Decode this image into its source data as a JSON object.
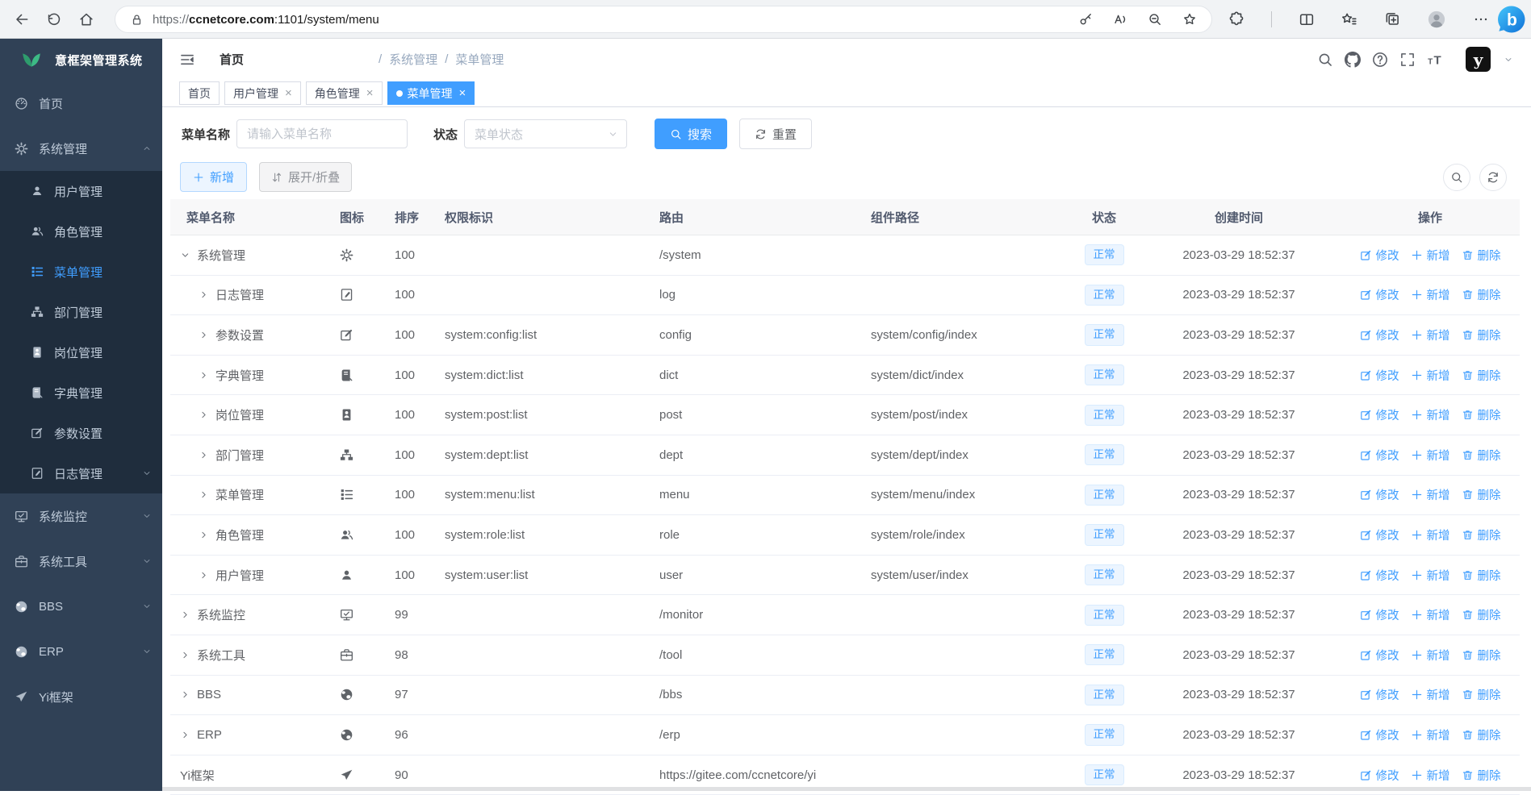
{
  "browser": {
    "url_prefix": "https://",
    "url_host": "ccnetcore.com",
    "url_path": ":1101/system/menu",
    "nav_buttons": [
      {
        "name": "back-button",
        "icon": "arrow-left"
      },
      {
        "name": "refresh-button",
        "icon": "reload"
      },
      {
        "name": "home-button",
        "icon": "home"
      }
    ],
    "address_icons": [
      {
        "name": "password-key-icon",
        "icon": "key"
      },
      {
        "name": "read-aloud-icon",
        "icon": "read-aloud"
      },
      {
        "name": "zoom-out-icon",
        "icon": "zoom-out"
      },
      {
        "name": "add-favorite-icon",
        "icon": "star-plus"
      }
    ],
    "action_icons": [
      {
        "name": "extensions-icon",
        "icon": "puzzle"
      },
      {
        "name": "toolbar-divider",
        "icon": "divider"
      },
      {
        "name": "split-screen-icon",
        "icon": "split"
      },
      {
        "name": "favorites-icon",
        "icon": "star-lines"
      },
      {
        "name": "collections-icon",
        "icon": "collections"
      },
      {
        "name": "profile-avatar-icon",
        "icon": "profile"
      },
      {
        "name": "settings-menu-icon",
        "icon": "ellipsis"
      }
    ],
    "corner_icon": {
      "name": "bing-chat-icon",
      "icon": "bing"
    }
  },
  "sidebar": {
    "logo_text": "意框架管理系统",
    "items": [
      {
        "key": "home",
        "label": "首页",
        "icon": "dashboard",
        "type": "root"
      },
      {
        "key": "system-management",
        "label": "系统管理",
        "icon": "gear",
        "type": "root",
        "chevron": "up",
        "expanded": true
      },
      {
        "key": "user-management",
        "label": "用户管理",
        "icon": "user",
        "type": "sub"
      },
      {
        "key": "role-management",
        "label": "角色管理",
        "icon": "users",
        "type": "sub"
      },
      {
        "key": "menu-management",
        "label": "菜单管理",
        "icon": "menu-tree",
        "type": "sub",
        "active": true
      },
      {
        "key": "dept-management",
        "label": "部门管理",
        "icon": "org-tree",
        "type": "sub"
      },
      {
        "key": "post-management",
        "label": "岗位管理",
        "icon": "badge",
        "type": "sub"
      },
      {
        "key": "dict-management",
        "label": "字典管理",
        "icon": "dict-book",
        "type": "sub"
      },
      {
        "key": "param-settings",
        "label": "参数设置",
        "icon": "edit-square",
        "type": "sub"
      },
      {
        "key": "log-management",
        "label": "日志管理",
        "icon": "log-edit",
        "type": "sub",
        "chevron": "down"
      },
      {
        "key": "system-monitor",
        "label": "系统监控",
        "icon": "monitor",
        "type": "root",
        "chevron": "down"
      },
      {
        "key": "system-tools",
        "label": "系统工具",
        "icon": "toolbox",
        "type": "root",
        "chevron": "down"
      },
      {
        "key": "bbs",
        "label": "BBS",
        "icon": "globe",
        "type": "root",
        "chevron": "down"
      },
      {
        "key": "erp",
        "label": "ERP",
        "icon": "globe",
        "type": "root",
        "chevron": "down"
      },
      {
        "key": "yi-framework",
        "label": "Yi框架",
        "icon": "send",
        "type": "root"
      }
    ]
  },
  "header": {
    "breadcrumb": [
      "首页",
      "系统管理",
      "菜单管理"
    ],
    "breadcrumb_separator": "/",
    "icons": [
      {
        "name": "search-icon",
        "icon": "search"
      },
      {
        "name": "github-icon",
        "icon": "github"
      },
      {
        "name": "help-icon",
        "icon": "question"
      },
      {
        "name": "fullscreen-icon",
        "icon": "fullscreen"
      },
      {
        "name": "font-size-icon",
        "icon": "font-size"
      }
    ],
    "avatar_text": "y"
  },
  "tabs": [
    {
      "key": "home",
      "label": "首页",
      "closable": false,
      "active": false
    },
    {
      "key": "user-management",
      "label": "用户管理",
      "closable": true,
      "active": false
    },
    {
      "key": "role-management",
      "label": "角色管理",
      "closable": true,
      "active": false
    },
    {
      "key": "menu-management",
      "label": "菜单管理",
      "closable": true,
      "active": true
    }
  ],
  "filters": {
    "name_label": "菜单名称",
    "name_placeholder": "请输入菜单名称",
    "status_label": "状态",
    "status_placeholder": "菜单状态",
    "search_label": "搜索",
    "reset_label": "重置"
  },
  "toolbar": {
    "add_label": "新增",
    "toggle_label": "展开/折叠"
  },
  "table": {
    "columns": [
      {
        "label": "菜单名称",
        "align": "left"
      },
      {
        "label": "图标",
        "align": "left"
      },
      {
        "label": "排序",
        "align": "left"
      },
      {
        "label": "权限标识",
        "align": "left"
      },
      {
        "label": "路由",
        "align": "left"
      },
      {
        "label": "组件路径",
        "align": "left"
      },
      {
        "label": "状态",
        "align": "center"
      },
      {
        "label": "创建时间",
        "align": "center"
      },
      {
        "label": "操作",
        "align": "center"
      }
    ],
    "ops": [
      {
        "name": "edit-link",
        "icon": "edit-pen",
        "label": "修改"
      },
      {
        "name": "add-link",
        "icon": "plus",
        "label": "新增"
      },
      {
        "name": "delete-link",
        "icon": "trash",
        "label": "删除"
      }
    ],
    "rows": [
      {
        "name": "系统管理",
        "level": 0,
        "arrow": "expanded",
        "icon": "gear",
        "order": "100",
        "perms": "",
        "route": "/system",
        "component": "",
        "status": "正常",
        "created": "2023-03-29 18:52:37"
      },
      {
        "name": "日志管理",
        "level": 1,
        "arrow": "collapsed",
        "icon": "log-edit",
        "order": "100",
        "perms": "",
        "route": "log",
        "component": "",
        "status": "正常",
        "created": "2023-03-29 18:52:37"
      },
      {
        "name": "参数设置",
        "level": 1,
        "arrow": "collapsed",
        "icon": "edit-square",
        "order": "100",
        "perms": "system:config:list",
        "route": "config",
        "component": "system/config/index",
        "status": "正常",
        "created": "2023-03-29 18:52:37"
      },
      {
        "name": "字典管理",
        "level": 1,
        "arrow": "collapsed",
        "icon": "dict-book",
        "order": "100",
        "perms": "system:dict:list",
        "route": "dict",
        "component": "system/dict/index",
        "status": "正常",
        "created": "2023-03-29 18:52:37"
      },
      {
        "name": "岗位管理",
        "level": 1,
        "arrow": "collapsed",
        "icon": "badge",
        "order": "100",
        "perms": "system:post:list",
        "route": "post",
        "component": "system/post/index",
        "status": "正常",
        "created": "2023-03-29 18:52:37"
      },
      {
        "name": "部门管理",
        "level": 1,
        "arrow": "collapsed",
        "icon": "org-tree",
        "order": "100",
        "perms": "system:dept:list",
        "route": "dept",
        "component": "system/dept/index",
        "status": "正常",
        "created": "2023-03-29 18:52:37"
      },
      {
        "name": "菜单管理",
        "level": 1,
        "arrow": "collapsed",
        "icon": "menu-tree",
        "order": "100",
        "perms": "system:menu:list",
        "route": "menu",
        "component": "system/menu/index",
        "status": "正常",
        "created": "2023-03-29 18:52:37"
      },
      {
        "name": "角色管理",
        "level": 1,
        "arrow": "collapsed",
        "icon": "users",
        "order": "100",
        "perms": "system:role:list",
        "route": "role",
        "component": "system/role/index",
        "status": "正常",
        "created": "2023-03-29 18:52:37"
      },
      {
        "name": "用户管理",
        "level": 1,
        "arrow": "collapsed",
        "icon": "user",
        "order": "100",
        "perms": "system:user:list",
        "route": "user",
        "component": "system/user/index",
        "status": "正常",
        "created": "2023-03-29 18:52:37"
      },
      {
        "name": "系统监控",
        "level": 0,
        "arrow": "collapsed",
        "icon": "monitor",
        "order": "99",
        "perms": "",
        "route": "/monitor",
        "component": "",
        "status": "正常",
        "created": "2023-03-29 18:52:37"
      },
      {
        "name": "系统工具",
        "level": 0,
        "arrow": "collapsed",
        "icon": "toolbox",
        "order": "98",
        "perms": "",
        "route": "/tool",
        "component": "",
        "status": "正常",
        "created": "2023-03-29 18:52:37"
      },
      {
        "name": "BBS",
        "level": 0,
        "arrow": "collapsed",
        "icon": "globe",
        "order": "97",
        "perms": "",
        "route": "/bbs",
        "component": "",
        "status": "正常",
        "created": "2023-03-29 18:52:37"
      },
      {
        "name": "ERP",
        "level": 0,
        "arrow": "collapsed",
        "icon": "globe",
        "order": "96",
        "perms": "",
        "route": "/erp",
        "component": "",
        "status": "正常",
        "created": "2023-03-29 18:52:37"
      },
      {
        "name": "Yi框架",
        "level": 0,
        "arrow": "none",
        "icon": "send",
        "order": "90",
        "perms": "",
        "route": "https://gitee.com/ccnetcore/yi",
        "component": "",
        "status": "正常",
        "created": "2023-03-29 18:52:37"
      }
    ]
  },
  "colors": {
    "accent": "#409eff",
    "sidebar_bg": "#304156",
    "submenu_bg": "#1f2d3d",
    "status_text": "#409eff",
    "status_bg": "#ecf5ff",
    "status_border": "#d9ecff"
  }
}
